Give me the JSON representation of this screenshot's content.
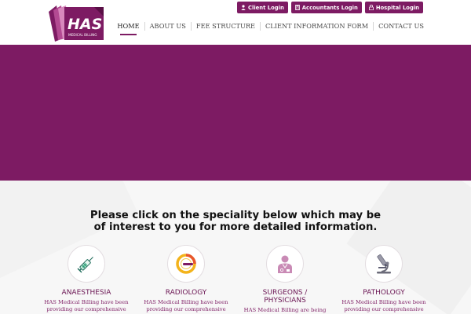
{
  "brand": {
    "logo_text": "HAS",
    "logo_subtext": "MEDICAL BILLING",
    "color": "#7d1b63"
  },
  "login_buttons": [
    {
      "label": "Client Login",
      "icon": "user-icon"
    },
    {
      "label": "Accountants Login",
      "icon": "calculator-icon"
    },
    {
      "label": "Hospital Login",
      "icon": "lock-icon"
    }
  ],
  "nav": [
    {
      "label": "HOME",
      "active": true
    },
    {
      "label": "ABOUT US"
    },
    {
      "label": "FEE STRUCTURE"
    },
    {
      "label": "CLIENT INFORMATION FORM"
    },
    {
      "label": "CONTACT US"
    }
  ],
  "headline": {
    "line1": "Please click on the speciality below which may be",
    "line2": "of interest to you for more detailed information."
  },
  "specialities": [
    {
      "title_line1": "ANAESTHESIA",
      "title_line2": "",
      "desc_line1": "HAS Medical Billing have been",
      "desc_line2": "providing our comprehensive",
      "icon": "syringe-icon"
    },
    {
      "title_line1": "RADIOLOGY",
      "title_line2": "",
      "desc_line1": "HAS Medical Billing have been",
      "desc_line2": "providing our comprehensive",
      "icon": "scanner-icon"
    },
    {
      "title_line1": "SURGEONS /",
      "title_line2": "PHYSICIANS",
      "desc_line1": "HAS Medical Billing are being",
      "desc_line2": "",
      "icon": "doctor-icon"
    },
    {
      "title_line1": "PATHOLOGY",
      "title_line2": "",
      "desc_line1": "HAS Medical Billing have been",
      "desc_line2": "providing our comprehensive",
      "icon": "microscope-icon"
    }
  ]
}
